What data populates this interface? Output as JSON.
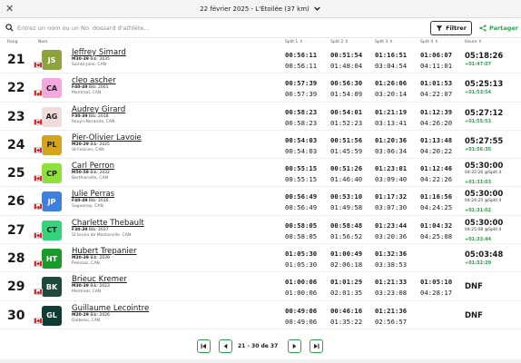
{
  "race": {
    "label": "22 février 2025 - L'Étoilée (37 km)",
    "close_icon": "close-icon",
    "chevron_icon": "chevron-down-icon"
  },
  "search": {
    "placeholder": "Entrez un nom ou un No. dossard d'athlète...",
    "value": ""
  },
  "toolbar": {
    "filter_label": "Filtrer",
    "share_label": "Partager"
  },
  "columns": {
    "rank": "Rang",
    "name": "Nom",
    "split1": "Split 1",
    "split2": "Split 2",
    "split3": "Split 3",
    "split4": "Split 4",
    "finish": "Heure"
  },
  "colors": {
    "accent": "#2e9e4f",
    "flag_red": "#d62a2a"
  },
  "rows": [
    {
      "rank": "21",
      "initials": "JS",
      "avatar_bg": "#8aa33a",
      "avatar_fg": "#ffffff",
      "name": "Jeffrey Simard",
      "category": "M30-39",
      "bib": "Bib: 2035",
      "city": "Sainte-Julie, CAN",
      "splits_top": [
        "00:56:11",
        "00:51:54",
        "01:16:51",
        "01:06:07"
      ],
      "splits_bot": [
        "00:56:11",
        "01:48:04",
        "03:04:54",
        "04:11:01"
      ],
      "finish": "05:18:26",
      "gap": "+01:47:07",
      "note": ""
    },
    {
      "rank": "22",
      "initials": "CA",
      "avatar_bg": "#f3a8e0",
      "avatar_fg": "#222222",
      "name": "cleo ascher",
      "category": "F40-49",
      "bib": "Bib: 2001",
      "city": "Montreal, CAN",
      "splits_top": [
        "00:57:39",
        "00:56:30",
        "01:26:06",
        "01:01:53"
      ],
      "splits_bot": [
        "00:57:39",
        "01:54:09",
        "03:20:14",
        "04:22:07"
      ],
      "finish": "05:25:13",
      "gap": "+01:53:54",
      "note": ""
    },
    {
      "rank": "23",
      "initials": "AG",
      "avatar_bg": "#f1dcdc",
      "avatar_fg": "#222222",
      "name": "Audrey Girard",
      "category": "F30-39",
      "bib": "Bib: 2018",
      "city": "Rouyn-Noranda, CAN",
      "splits_top": [
        "00:58:23",
        "00:54:01",
        "01:21:19",
        "01:12:39"
      ],
      "splits_bot": [
        "00:58:23",
        "01:52:23",
        "03:13:41",
        "04:26:20"
      ],
      "finish": "05:27:12",
      "gap": "+01:55:53",
      "note": ""
    },
    {
      "rank": "24",
      "initials": "PL",
      "avatar_bg": "#d4a51c",
      "avatar_fg": "#222222",
      "name": "Pier-Olivier Lavoie",
      "category": "M20-29",
      "bib": "Bib: 2025",
      "city": "St-Felicien, CAN",
      "splits_top": [
        "00:54:03",
        "00:51:56",
        "01:20:36",
        "01:13:48"
      ],
      "splits_bot": [
        "00:54:03",
        "01:45:59",
        "03:06:34",
        "04:20:22"
      ],
      "finish": "05:27:55",
      "gap": "+01:56:35",
      "note": ""
    },
    {
      "rank": "25",
      "initials": "CP",
      "avatar_bg": "#8ee03a",
      "avatar_fg": "#222222",
      "name": "Carl Perron",
      "category": "M50-59",
      "bib": "Bib: 2032",
      "city": "Berthierville, CAN",
      "splits_top": [
        "00:55:15",
        "00:51:26",
        "01:23:01",
        "01:12:46"
      ],
      "splits_bot": [
        "00:55:15",
        "01:46:40",
        "03:09:40",
        "04:22:26"
      ],
      "finish": "05:30:00",
      "gap": "+01:31:03",
      "note": "04:22:26 @Split 4"
    },
    {
      "rank": "26",
      "initials": "JP",
      "avatar_bg": "#3f7fe0",
      "avatar_fg": "#ffffff",
      "name": "Julie Perras",
      "category": "F40-49",
      "bib": "Bib: 2030",
      "city": "Saguenay, CAN",
      "splits_top": [
        "00:56:49",
        "00:53:10",
        "01:17:32",
        "01:16:56"
      ],
      "splits_bot": [
        "00:56:49",
        "01:49:58",
        "03:07:30",
        "04:24:25"
      ],
      "finish": "05:30:00",
      "gap": "+01:31:02",
      "note": "04:24:25 @Split 4"
    },
    {
      "rank": "27",
      "initials": "CT",
      "avatar_bg": "#34d47a",
      "avatar_fg": "#222222",
      "name": "Charlette Thebault",
      "category": "F30-39",
      "bib": "Bib: 2037",
      "city": "St bruno de Montarville, CAN",
      "splits_top": [
        "00:58:05",
        "00:58:48",
        "01:23:44",
        "01:04:32"
      ],
      "splits_bot": [
        "00:58:05",
        "01:56:52",
        "03:20:36",
        "04:25:08"
      ],
      "finish": "05:30:00",
      "gap": "+01:33:44",
      "note": "04:25:08 @Split 4"
    },
    {
      "rank": "28",
      "initials": "HT",
      "avatar_bg": "#1a9a2a",
      "avatar_fg": "#ffffff",
      "name": "Hubert Trepanier",
      "category": "M30-39",
      "bib": "Bib: 2039",
      "city": "Preissac, CAN",
      "splits_top": [
        "01:05:30",
        "01:00:49",
        "01:32:36",
        ""
      ],
      "splits_bot": [
        "01:05:30",
        "02:06:18",
        "03:38:53",
        ""
      ],
      "finish": "05:03:48",
      "gap": "+01:32:29",
      "note": ""
    },
    {
      "rank": "29",
      "initials": "BK",
      "avatar_bg": "#1f4a3a",
      "avatar_fg": "#ffffff",
      "name": "Brieuc Kremer",
      "category": "M30-39",
      "bib": "Bib: 2023",
      "city": "Montreal, CAN",
      "splits_top": [
        "01:00:06",
        "01:01:29",
        "01:21:33",
        "01:05:10"
      ],
      "splits_bot": [
        "01:00:06",
        "02:01:35",
        "03:23:08",
        "04:28:17"
      ],
      "finish": "DNF",
      "gap": "",
      "note": ""
    },
    {
      "rank": "30",
      "initials": "GL",
      "avatar_bg": "#0f3d35",
      "avatar_fg": "#ffffff",
      "name": "Guillaume Lecointre",
      "category": "M20-29",
      "bib": "Bib: 2026",
      "city": "Dolbeau, CAN",
      "splits_top": [
        "00:49:06",
        "00:46:16",
        "01:21:36",
        ""
      ],
      "splits_bot": [
        "00:49:06",
        "01:35:22",
        "02:56:57",
        ""
      ],
      "finish": "DNF",
      "gap": "",
      "note": ""
    }
  ],
  "pagination": {
    "label": "21 - 30 de 37"
  }
}
